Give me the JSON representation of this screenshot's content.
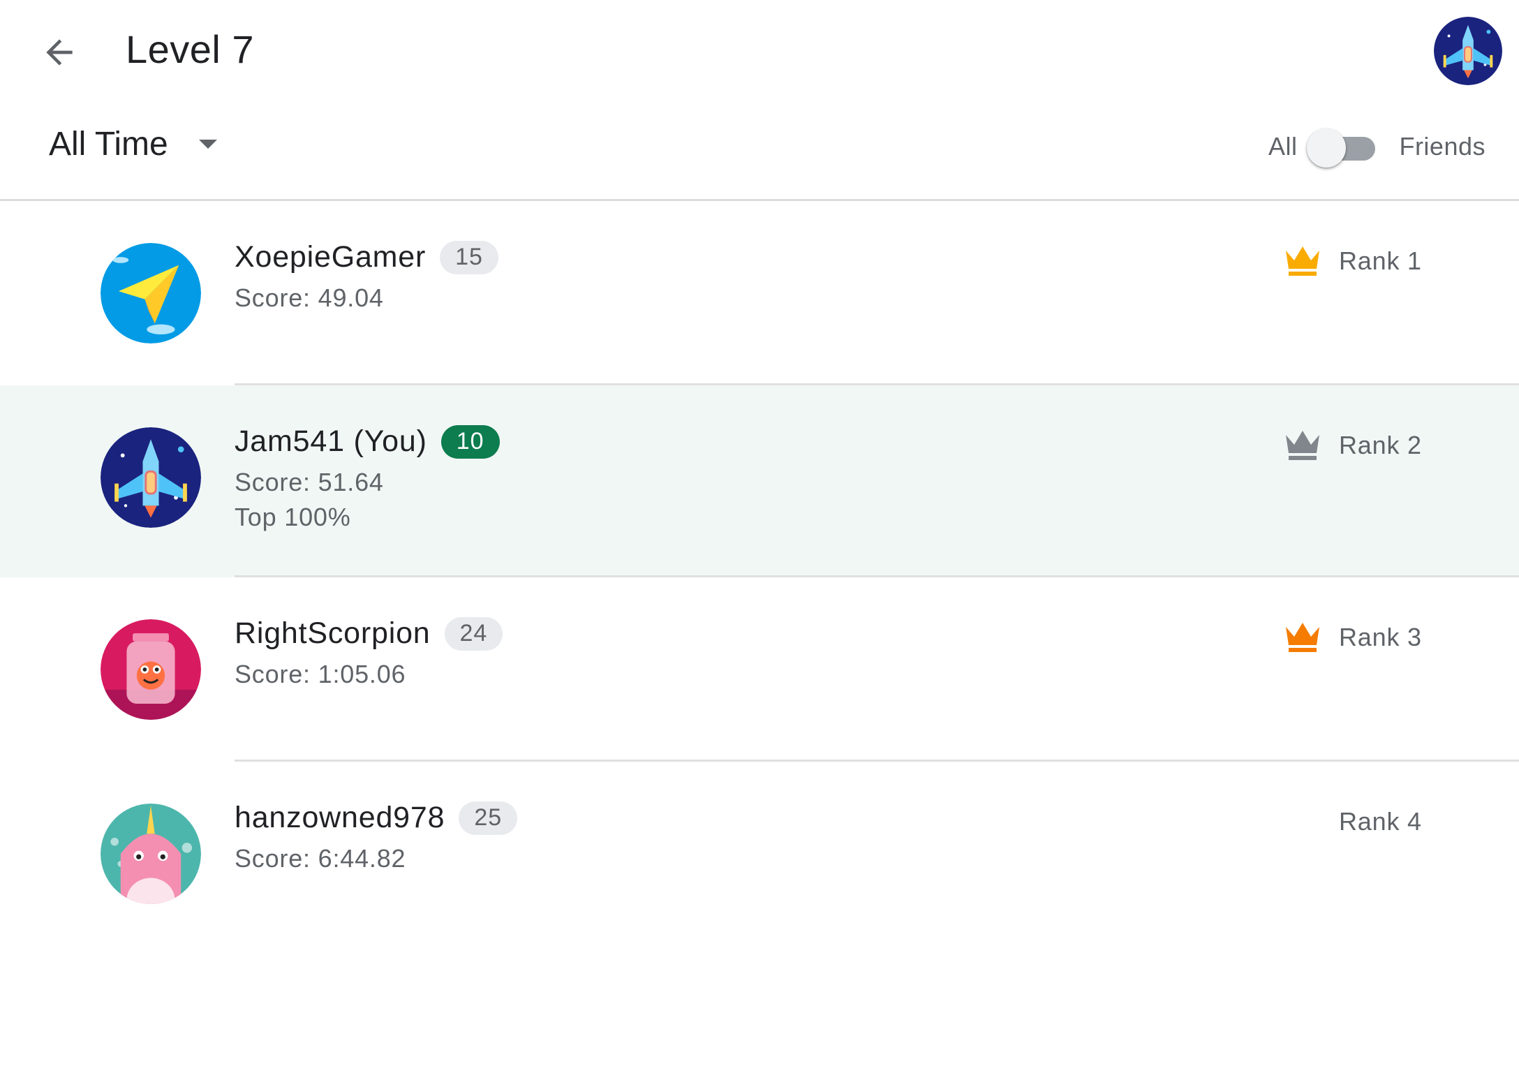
{
  "header": {
    "title": "Level 7",
    "back_icon": "arrow-back-icon",
    "account_avatar": "spaceship-avatar"
  },
  "filters": {
    "time_range": "All Time",
    "scope_left": "All",
    "scope_right": "Friends",
    "scope_selected": "All"
  },
  "colors": {
    "gold": "#f9ab00",
    "silver": "#80868b",
    "bronze": "#f57c00",
    "my_chip": "#0d7c4f",
    "my_row_bg": "#f1f7f5"
  },
  "leaderboard": [
    {
      "name": "XoepieGamer",
      "level": "15",
      "score": "Score: 49.04",
      "rank": "Rank 1",
      "crown": "gold-crown-icon",
      "avatar": "paper-plane-avatar"
    },
    {
      "name": "Jam541 (You)",
      "level": "10",
      "score": "Score: 51.64",
      "percentile": "Top 100%",
      "rank": "Rank 2",
      "crown": "silver-crown-icon",
      "avatar": "spaceship-avatar",
      "is_me": true
    },
    {
      "name": "RightScorpion",
      "level": "24",
      "score": "Score: 1:05.06",
      "rank": "Rank 3",
      "crown": "bronze-crown-icon",
      "avatar": "jar-creature-avatar"
    },
    {
      "name": "hanzowned978",
      "level": "25",
      "score": "Score: 6:44.82",
      "rank": "Rank 4",
      "avatar": "narwhal-avatar"
    }
  ]
}
